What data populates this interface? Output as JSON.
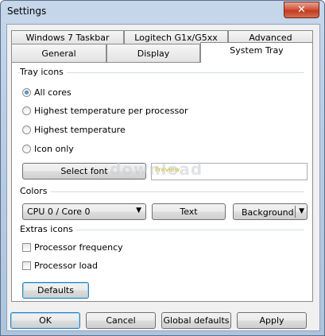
{
  "window": {
    "title": "Settings",
    "close_glyph": "✕"
  },
  "tabs_top": [
    "Windows 7 Taskbar",
    "Logitech G1x/G5xx",
    "Advanced"
  ],
  "tabs_bottom": [
    "General",
    "Display",
    "System Tray"
  ],
  "tray_icons": {
    "group_label": "Tray icons",
    "options": [
      "All cores",
      "Highest temperature per processor",
      "Highest temperature",
      "Icon only"
    ],
    "selected_index": 0,
    "select_font_label": "Select font",
    "preview_text": "Preview"
  },
  "colors": {
    "group_label": "Colors",
    "core_select_value": "CPU 0 / Core 0",
    "text_button": "Text",
    "background_button": "Background"
  },
  "extras": {
    "group_label": "Extras icons",
    "processor_frequency": "Processor frequency",
    "processor_load": "Processor load"
  },
  "defaults_label": "Defaults",
  "footer": {
    "ok": "OK",
    "cancel": "Cancel",
    "global_defaults": "Global defaults",
    "apply": "Apply"
  },
  "watermark": "download"
}
